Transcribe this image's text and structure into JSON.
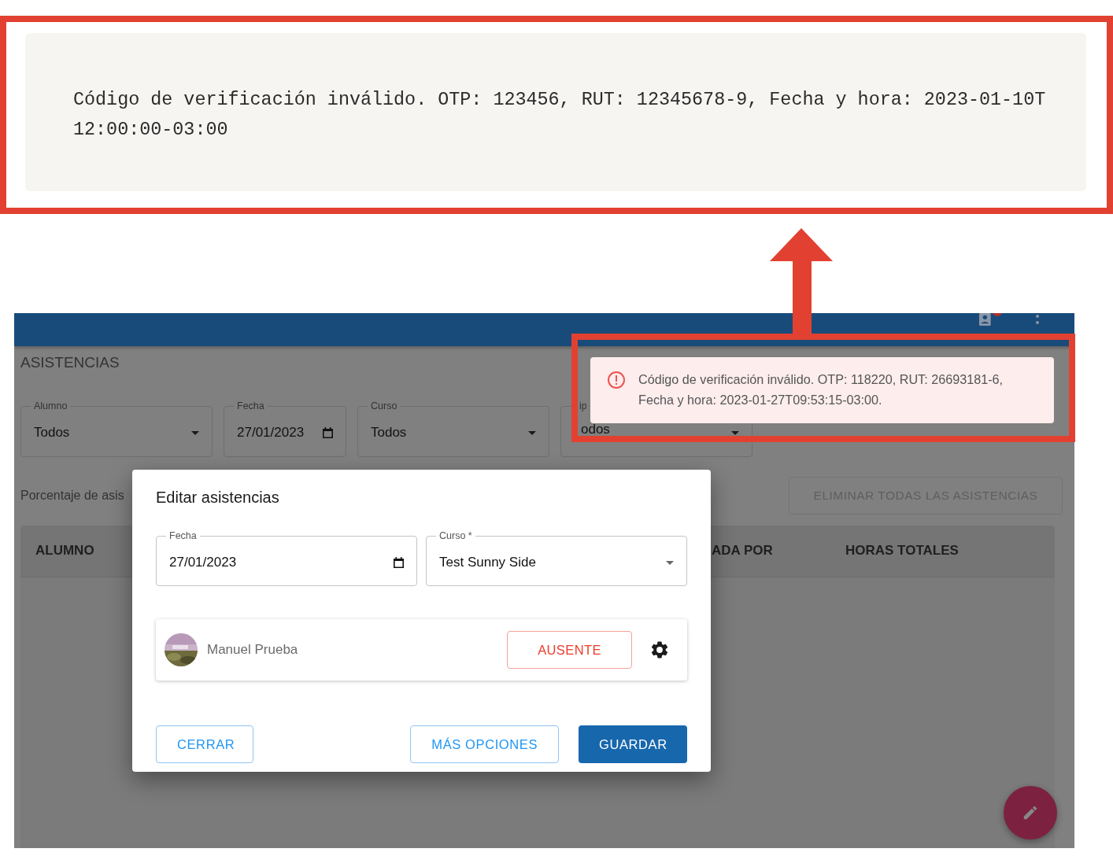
{
  "callout": {
    "text": "Código de verificación inválido. OTP: 123456, RUT: 12345678-9, Fecha y hora: 2023-01-10T 12:00:00-03:00"
  },
  "app": {
    "app_bar": {
      "notification_badge": true
    },
    "page_title": "ASISTENCIAS",
    "filters": [
      {
        "label": "Alumno",
        "value": "Todos",
        "kind": "select"
      },
      {
        "label": "Fecha",
        "value": "27/01/2023",
        "kind": "date"
      },
      {
        "label": "Curso",
        "value": "Todos",
        "kind": "select"
      },
      {
        "label": "ip",
        "value": "odos",
        "kind": "select"
      }
    ],
    "percentage_label": "Porcentaje de asis",
    "delete_all_button": {
      "label": "ELIMINAR TODAS LAS ASISTENCIAS",
      "disabled": true
    },
    "table": {
      "columns": [
        "ALUMNO",
        "ADA POR",
        "HORAS TOTALES"
      ]
    },
    "toast": {
      "message": "Código de verificación inválido. OTP: 118220, RUT: 26693181-6, Fecha y hora: 2023-01-27T09:53:15-03:00."
    },
    "dialog": {
      "title": "Editar asistencias",
      "fields": [
        {
          "label": "Fecha",
          "value": "27/01/2023",
          "kind": "date"
        },
        {
          "label": "Curso *",
          "value": "Test Sunny Side",
          "kind": "select"
        }
      ],
      "students": [
        {
          "name": "Manuel Prueba",
          "status": "AUSENTE"
        }
      ],
      "buttons": [
        {
          "label": "CERRAR",
          "kind": "outlined"
        },
        {
          "label": "MÁS OPCIONES",
          "kind": "outlined"
        },
        {
          "label": "GUARDAR",
          "kind": "contained"
        }
      ]
    }
  }
}
